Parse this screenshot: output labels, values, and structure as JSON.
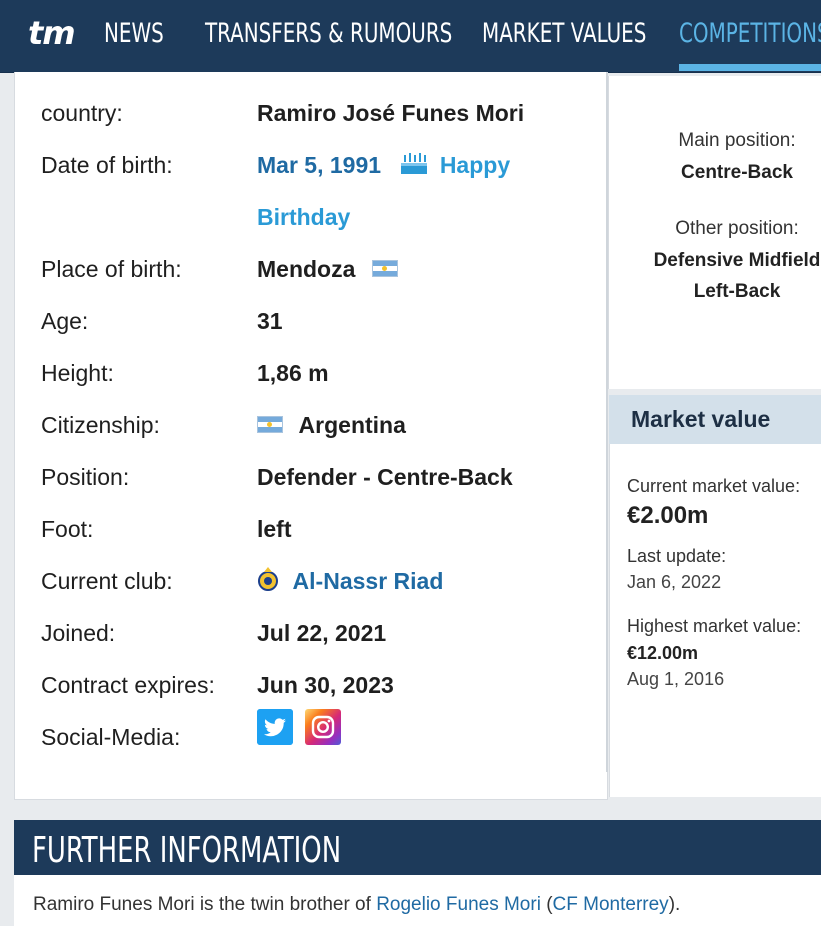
{
  "nav": {
    "logo": "tm",
    "items": [
      {
        "label": "NEWS"
      },
      {
        "label": "TRANSFERS & RUMOURS"
      },
      {
        "label": "MARKET VALUES"
      },
      {
        "label": "COMPETITIONS",
        "active": true
      }
    ]
  },
  "profile": {
    "rows": [
      {
        "label": "country:",
        "value": "Ramiro José Funes Mori"
      },
      {
        "label": "Date of birth:",
        "value": "Mar 5, 1991",
        "extra_line1": "Happy",
        "extra_line2": "Birthday"
      },
      {
        "label": "Place of birth:",
        "value": "Mendoza"
      },
      {
        "label": "Age:",
        "value": "31"
      },
      {
        "label": "Height:",
        "value": "1,86 m"
      },
      {
        "label": "Citizenship:",
        "value": "Argentina"
      },
      {
        "label": "Position:",
        "value": "Defender - Centre-Back"
      },
      {
        "label": "Foot:",
        "value": "left"
      },
      {
        "label": "Current club:",
        "value": "Al-Nassr Riad"
      },
      {
        "label": "Joined:",
        "value": "Jul 22, 2021"
      },
      {
        "label": "Contract expires:",
        "value": "Jun 30, 2023"
      },
      {
        "label": "Social-Media:",
        "value": ""
      }
    ],
    "flag_icon": "argentina-flag",
    "colors": {
      "link": "#1f6aa3",
      "link_light": "#2a9ad6"
    }
  },
  "positions": {
    "main_label": "Main position:",
    "main_value": "Centre-Back",
    "other_label": "Other position:",
    "other_values": [
      "Defensive Midfield",
      "Left-Back"
    ]
  },
  "market_value": {
    "title": "Market value",
    "current_label": "Current market value:",
    "current_value": "€2.00m",
    "last_update_label": "Last update:",
    "last_update_value": "Jan 6, 2022",
    "highest_label": "Highest market value:",
    "highest_value": "€12.00m",
    "highest_date": "Aug 1, 2016"
  },
  "further_info": {
    "title": "FURTHER INFORMATION",
    "text_before": "Ramiro Funes Mori is the twin brother of ",
    "link1": "Rogelio Funes Mori",
    "text_middle": " (",
    "link2": "CF Monterrey",
    "text_after": ")."
  },
  "theme": {
    "navy": "#1d3a5a",
    "accent": "#5bb4e5",
    "mv_header_bg": "#d3e0ea"
  }
}
